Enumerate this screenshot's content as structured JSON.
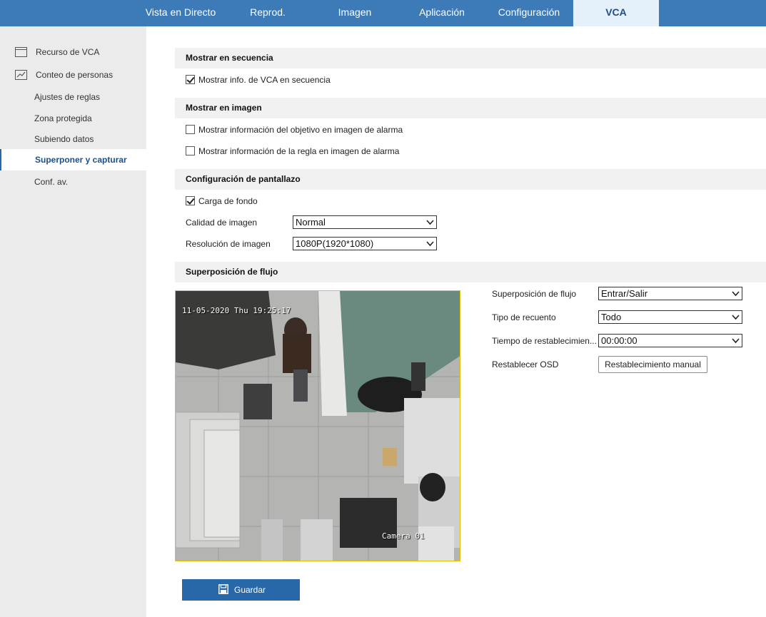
{
  "nav": {
    "tabs": [
      {
        "label": "Vista en Directo"
      },
      {
        "label": "Reprod."
      },
      {
        "label": "Imagen"
      },
      {
        "label": "Aplicación"
      },
      {
        "label": "Configuración"
      },
      {
        "label": "VCA"
      }
    ],
    "active": "VCA"
  },
  "sidebar": {
    "items": [
      {
        "label": "Recurso de VCA",
        "icon": "window-icon"
      },
      {
        "label": "Conteo de personas",
        "icon": "chart-icon"
      },
      {
        "label": "Ajustes de reglas"
      },
      {
        "label": "Zona protegida"
      },
      {
        "label": "Subiendo datos"
      },
      {
        "label": "Superponer y capturar"
      },
      {
        "label": "Conf. av."
      }
    ],
    "active": "Superponer y capturar"
  },
  "sections": {
    "stream": {
      "title": "Mostrar en secuencia",
      "vca_info_label": "Mostrar info. de VCA en secuencia",
      "vca_info_checked": true
    },
    "image": {
      "title": "Mostrar en imagen",
      "target_info_label": "Mostrar información del objetivo en imagen de alarma",
      "target_info_checked": false,
      "rule_info_label": "Mostrar información de la regla en imagen de alarma",
      "rule_info_checked": false
    },
    "snapshot": {
      "title": "Configuración de pantallazo",
      "background_upload_label": "Carga de fondo",
      "background_upload_checked": true,
      "quality_label": "Calidad de imagen",
      "quality_value": "Normal",
      "resolution_label": "Resolución de imagen",
      "resolution_value": "1080P(1920*1080)"
    },
    "overlay": {
      "title": "Superposición de flujo",
      "flow_overlay_label": "Superposición de flujo",
      "flow_overlay_value": "Entrar/Salir",
      "count_type_label": "Tipo de recuento",
      "count_type_value": "Todo",
      "reset_time_label": "Tiempo de restablecimien...",
      "reset_time_value": "00:00:00",
      "reset_osd_label": "Restablecer OSD",
      "reset_osd_button": "Restablecimiento manual"
    }
  },
  "preview": {
    "timestamp": "11-05-2020 Thu 19:25:17",
    "camera_name": "Camera 01"
  },
  "save_label": "Guardar",
  "colors": {
    "nav_bg": "#3d7ab8",
    "accent": "#2868a8",
    "active_tab_bg": "#e4f1fa"
  }
}
